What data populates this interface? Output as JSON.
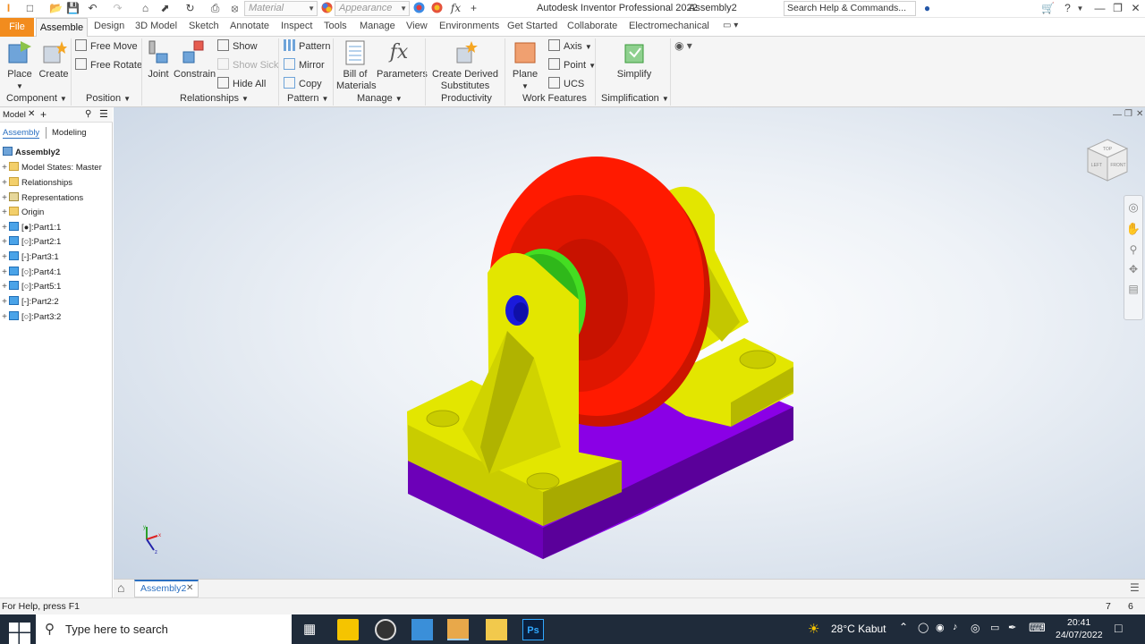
{
  "app": {
    "title": "Autodesk Inventor Professional 2022",
    "document": "Assembly2"
  },
  "quick_access": {
    "material_placeholder": "Material",
    "appearance_placeholder": "Appearance",
    "search_placeholder": "Search Help & Commands..."
  },
  "tabs": [
    "File",
    "Assemble",
    "Design",
    "3D Model",
    "Sketch",
    "Annotate",
    "Inspect",
    "Tools",
    "Manage",
    "View",
    "Environments",
    "Get Started",
    "Collaborate",
    "Electromechanical"
  ],
  "ribbon": {
    "component": {
      "title": "Component",
      "place": "Place",
      "create": "Create"
    },
    "position": {
      "title": "Position",
      "free_move": "Free Move",
      "free_rotate": "Free Rotate"
    },
    "relationships": {
      "title": "Relationships",
      "joint": "Joint",
      "constrain": "Constrain",
      "show": "Show",
      "show_sick": "Show Sick",
      "hide_all": "Hide All"
    },
    "pattern": {
      "title": "Pattern",
      "pattern": "Pattern",
      "mirror": "Mirror",
      "copy": "Copy"
    },
    "manage": {
      "title": "Manage",
      "bom_line1": "Bill of",
      "bom_line2": "Materials",
      "parameters": "Parameters"
    },
    "productivity": {
      "title": "Productivity",
      "derived_line1": "Create Derived",
      "derived_line2": "Substitutes"
    },
    "work_features": {
      "title": "Work Features",
      "plane": "Plane",
      "axis": "Axis",
      "point": "Point",
      "ucs": "UCS"
    },
    "simplification": {
      "title": "Simplification",
      "simplify": "Simplify"
    }
  },
  "browser": {
    "title": "Model",
    "tab_assembly": "Assembly",
    "tab_modeling": "Modeling",
    "root": "Assembly2",
    "nodes": [
      "Model States: Master",
      "Relationships",
      "Representations",
      "Origin",
      "[●]:Part1:1",
      "[○]:Part2:1",
      "[-]:Part3:1",
      "[○]:Part4:1",
      "[○]:Part5:1",
      "[-]:Part2:2",
      "[○]:Part3:2"
    ]
  },
  "document_tab": "Assembly2",
  "status": {
    "help": "For Help, press F1",
    "count_a": "7",
    "count_b": "6"
  },
  "taskbar": {
    "search_placeholder": "Type here to search",
    "weather": "28°C  Kabut",
    "time": "20:41",
    "date": "24/07/2022"
  },
  "colors": {
    "file_tab": "#f28c1e",
    "red_part": "#ff1a00",
    "yellow_part": "#e3e600",
    "purple_part": "#8a00e6",
    "green_part": "#44dd22",
    "blue_pin": "#1a1adb"
  },
  "viewcube_faces": {
    "top": "TOP",
    "left": "LEFT",
    "front": "FRONT"
  }
}
